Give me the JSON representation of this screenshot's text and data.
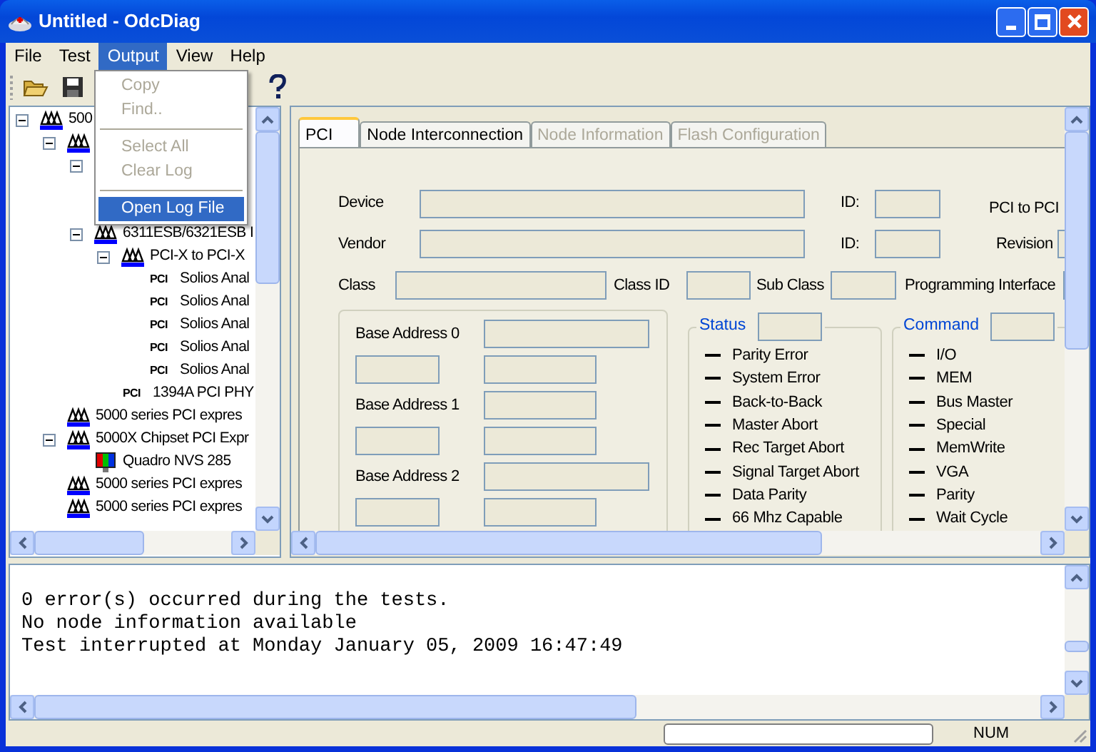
{
  "window": {
    "title": "Untitled - OdcDiag"
  },
  "menu_bar": [
    {
      "label": "File",
      "selected": false
    },
    {
      "label": "Test",
      "selected": false
    },
    {
      "label": "Output",
      "selected": true
    },
    {
      "label": "View",
      "selected": false
    },
    {
      "label": "Help",
      "selected": false
    }
  ],
  "output_menu": [
    {
      "kind": "item",
      "label": "Copy",
      "disabled": true,
      "selected": false
    },
    {
      "kind": "item",
      "label": "Find..",
      "disabled": true,
      "selected": false
    },
    {
      "kind": "separator"
    },
    {
      "kind": "item",
      "label": "Select All",
      "disabled": true,
      "selected": false
    },
    {
      "kind": "item",
      "label": "Clear Log",
      "disabled": true,
      "selected": false
    },
    {
      "kind": "separator"
    },
    {
      "kind": "item",
      "label": "Open Log File",
      "disabled": false,
      "selected": true
    }
  ],
  "tree": [
    {
      "kind": "bridge",
      "label": "500",
      "expanded": true,
      "children": [
        {
          "kind": "bridge",
          "expanded": true,
          "children": [
            {
              "kind": "hidden",
              "expanded": true
            },
            {
              "kind": "bridge",
              "label": "6311ESB/6321ESB I",
              "expanded": true,
              "children": [
                {
                  "kind": "bridge",
                  "label": "PCI-X to PCI-X",
                  "expanded": true,
                  "children": [
                    {
                      "kind": "pci",
                      "badge": "PCI",
                      "label": "Solios Anal"
                    },
                    {
                      "kind": "pci",
                      "badge": "PCI",
                      "label": "Solios Anal"
                    },
                    {
                      "kind": "pci",
                      "badge": "PCI",
                      "label": "Solios Anal"
                    },
                    {
                      "kind": "pci",
                      "badge": "PCI",
                      "label": "Solios Anal"
                    },
                    {
                      "kind": "pci",
                      "badge": "PCI",
                      "label": "Solios Anal"
                    }
                  ]
                },
                {
                  "kind": "pci",
                  "badge": "PCI",
                  "label": "1394A PCI PHY"
                }
              ]
            }
          ]
        },
        {
          "kind": "bridge",
          "label": "5000 series PCI expres"
        },
        {
          "kind": "bridge",
          "label": "5000X Chipset PCI Expr",
          "expanded": true,
          "children": [
            {
              "kind": "display",
              "label": "Quadro NVS 285"
            }
          ]
        },
        {
          "kind": "bridge",
          "label": "5000 series PCI expres"
        },
        {
          "kind": "bridge",
          "label": "5000 series PCI expres"
        }
      ]
    }
  ],
  "tabs": [
    {
      "label": "PCI",
      "selected": true,
      "disabled": false
    },
    {
      "label": "Node Interconnection",
      "selected": false,
      "disabled": false
    },
    {
      "label": "Node Information",
      "selected": false,
      "disabled": true
    },
    {
      "label": "Flash Configuration",
      "selected": false,
      "disabled": true
    }
  ],
  "pci": {
    "device_label": "Device",
    "vendor_label": "Vendor",
    "id_labels": [
      "ID:",
      "ID:"
    ],
    "pci_to_pci_label": "PCI to PCI",
    "revision_label": "Revision",
    "class_label": "Class",
    "class_id_label": "Class ID",
    "sub_class_label": "Sub Class",
    "programming_interface_label": "Programming Interface",
    "base_addresses": [
      "Base Address 0",
      "Base Address 1",
      "Base Address 2"
    ],
    "status": {
      "title": "Status",
      "flags": [
        "Parity Error",
        "System Error",
        "Back-to-Back",
        "Master Abort",
        "Rec Target Abort",
        "Signal Target Abort",
        "Data Parity",
        "66 Mhz Capable"
      ]
    },
    "command": {
      "title": "Command",
      "flags": [
        "I/O",
        "MEM",
        "Bus Master",
        "Special",
        "MemWrite",
        "VGA",
        "Parity",
        "Wait Cycle"
      ]
    }
  },
  "log": [
    "0 error(s) occurred during the tests.",
    "No node information available",
    "Test interrupted at Monday January 05, 2009 16:47:49"
  ],
  "status_bar": {
    "progress": {
      "level": 0
    },
    "num": "NUM"
  }
}
